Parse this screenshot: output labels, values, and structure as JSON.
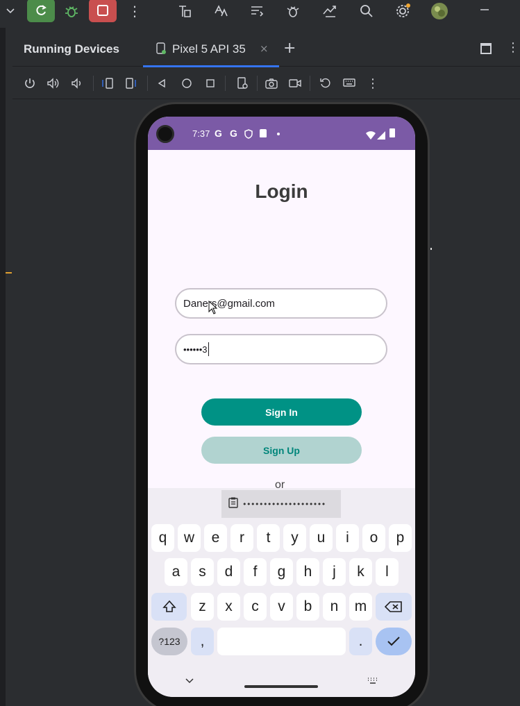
{
  "ide": {
    "panel_title": "Running Devices",
    "device_tab": "Pixel 5 API 35"
  },
  "status_bar": {
    "time": "7:37"
  },
  "app": {
    "title": "Login",
    "email_value": "Daners@gmail.com",
    "password_value": "••••••3",
    "sign_in_label": "Sign In",
    "sign_up_label": "Sign Up",
    "or_label": "or"
  },
  "keyboard": {
    "clipboard_text": "••••••••••••••••••••",
    "row1": [
      "q",
      "w",
      "e",
      "r",
      "t",
      "y",
      "u",
      "i",
      "o",
      "p"
    ],
    "row2": [
      "a",
      "s",
      "d",
      "f",
      "g",
      "h",
      "j",
      "k",
      "l"
    ],
    "row3": [
      "z",
      "x",
      "c",
      "v",
      "b",
      "n",
      "m"
    ],
    "symbols_label": "?123",
    "comma_label": ",",
    "period_label": "."
  },
  "colors": {
    "status_bar": "#7b5aa6",
    "sign_in": "#009285",
    "sign_up": "#b1d3d0",
    "run_button": "#4c8c4a",
    "stop_button": "#c94f4f"
  }
}
